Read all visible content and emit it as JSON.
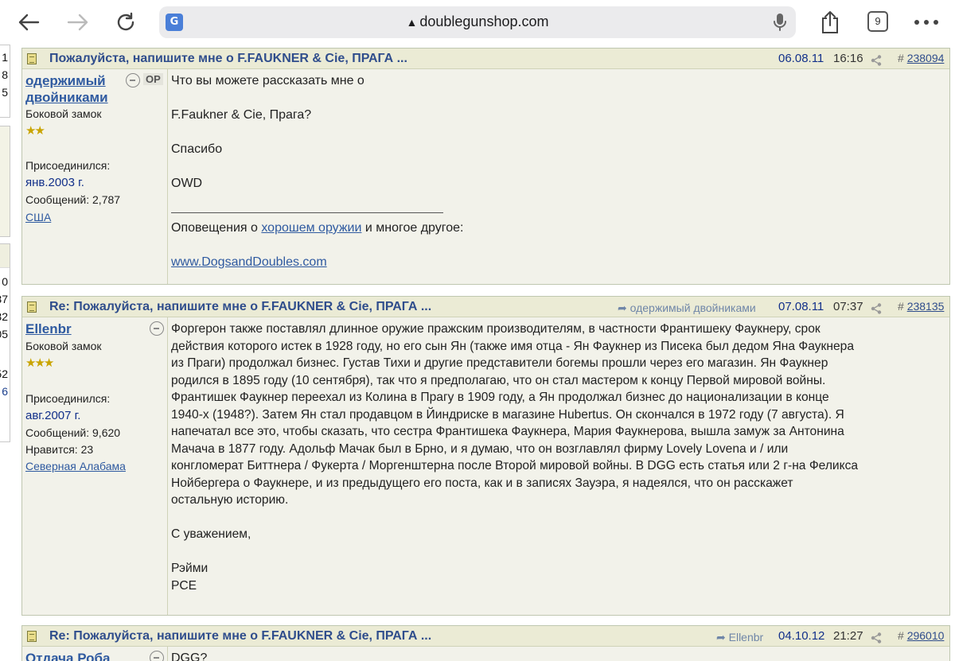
{
  "browser": {
    "url": "doublegunshop.com",
    "tab_count": "9",
    "translate_label": "G"
  },
  "left_column": {
    "top_numbers": [
      "1",
      "8",
      "5"
    ],
    "mid_numbers": [
      "0",
      "37",
      "32",
      "05"
    ],
    "bottom_numbers": [
      "52",
      "6"
    ]
  },
  "posts": [
    {
      "subject": "Пожалуйста, напишите мне о F.FAUKNER & Cie, ПРАГА ...",
      "date": "06.08.11",
      "time": "16:16",
      "number_prefix": "#",
      "number": "238094",
      "author": {
        "name": "одержимый двойниками",
        "op_tag": "OP",
        "title": "Боковой замок",
        "stars": "★★",
        "joined_label": "Присоединился:",
        "joined": "янв.2003 г.",
        "posts_label": "Сообщений:",
        "posts": "2,787",
        "location": "США"
      },
      "body": {
        "line1": "Что вы можете рассказать мне о",
        "line2": "F.Faukner & Cie, Прага?",
        "line3": "Спасибо",
        "line4": "OWD",
        "sig_before": "Оповещения о ",
        "sig_link": "хорошем оружии",
        "sig_after": " и многое другое:",
        "sig_url": "www.DogsandDoubles.com"
      }
    },
    {
      "subject": "Re: Пожалуйста, напишите мне о F.FAUKNER & Cie, ПРАГА ...",
      "reply_to": "одержимый двойниками",
      "date": "07.08.11",
      "time": "07:37",
      "number_prefix": "#",
      "number": "238135",
      "author": {
        "name": "Ellenbr",
        "title": "Боковой замок",
        "stars": "★★★",
        "joined_label": "Присоединился:",
        "joined": "авг.2007 г.",
        "posts_label": "Сообщений:",
        "posts": "9,620",
        "likes_label": "Нравится:",
        "likes": "23",
        "location": "Северная Алабама"
      },
      "body": {
        "l1": "Форгерон также поставлял длинное оружие пражским производителям, в частности Франтишеку Фаукнеру, срок",
        "l2": "действия которого истек в 1928 году, но его сын Ян (также имя отца - Ян Фаукнер из Писека был дедом Яна Фаукнера",
        "l3": "из Праги) продолжал бизнес. Густав Тихи и другие представители богемы прошли через его магазин. Ян Фаукнер",
        "l4": "родился в 1895 году (10 сентября), так что я предполагаю, что он стал мастером к концу Первой мировой войны.",
        "l5": "Франтишек Фаукнер переехал из Колина в Прагу в 1909 году, а Ян продолжал бизнес до национализации в конце",
        "l6": "1940-х (1948?). Затем Ян стал продавцом в Йиндриске в магазине Hubertus. Он скончался в 1972 году (7 августа). Я",
        "l7": "напечатал все это, чтобы сказать, что сестра Франтишека Фаукнера, Мария Фаукнерова, вышла замуж за Антонина",
        "l8": "Мачача в 1877 году. Адольф Мачак был в Брно, и я думаю, что он возглавлял фирму Lovely Lovena и / или",
        "l9": "конгломерат Биттнера / Фукерта / Моргенштерна после Второй мировой войны. В DGG есть статья или 2 г-на Феликса",
        "l10": "Нойбергера о Фаукнере, и из предыдущего его поста, как и в записях Зауэра, я надеялся, что он расскажет",
        "l11": "остальную историю.",
        "regards": "С уважением,",
        "sign1": "Рэйми",
        "sign2": "PCE"
      }
    },
    {
      "subject": "Re: Пожалуйста, напишите мне о F.FAUKNER & Cie, ПРАГА ...",
      "reply_to": "Ellenbr",
      "date": "04.10.12",
      "time": "21:27",
      "number_prefix": "#",
      "number": "296010",
      "author": {
        "name": "Отдача Роба"
      },
      "body": {
        "line1": "DGG?"
      }
    }
  ]
}
